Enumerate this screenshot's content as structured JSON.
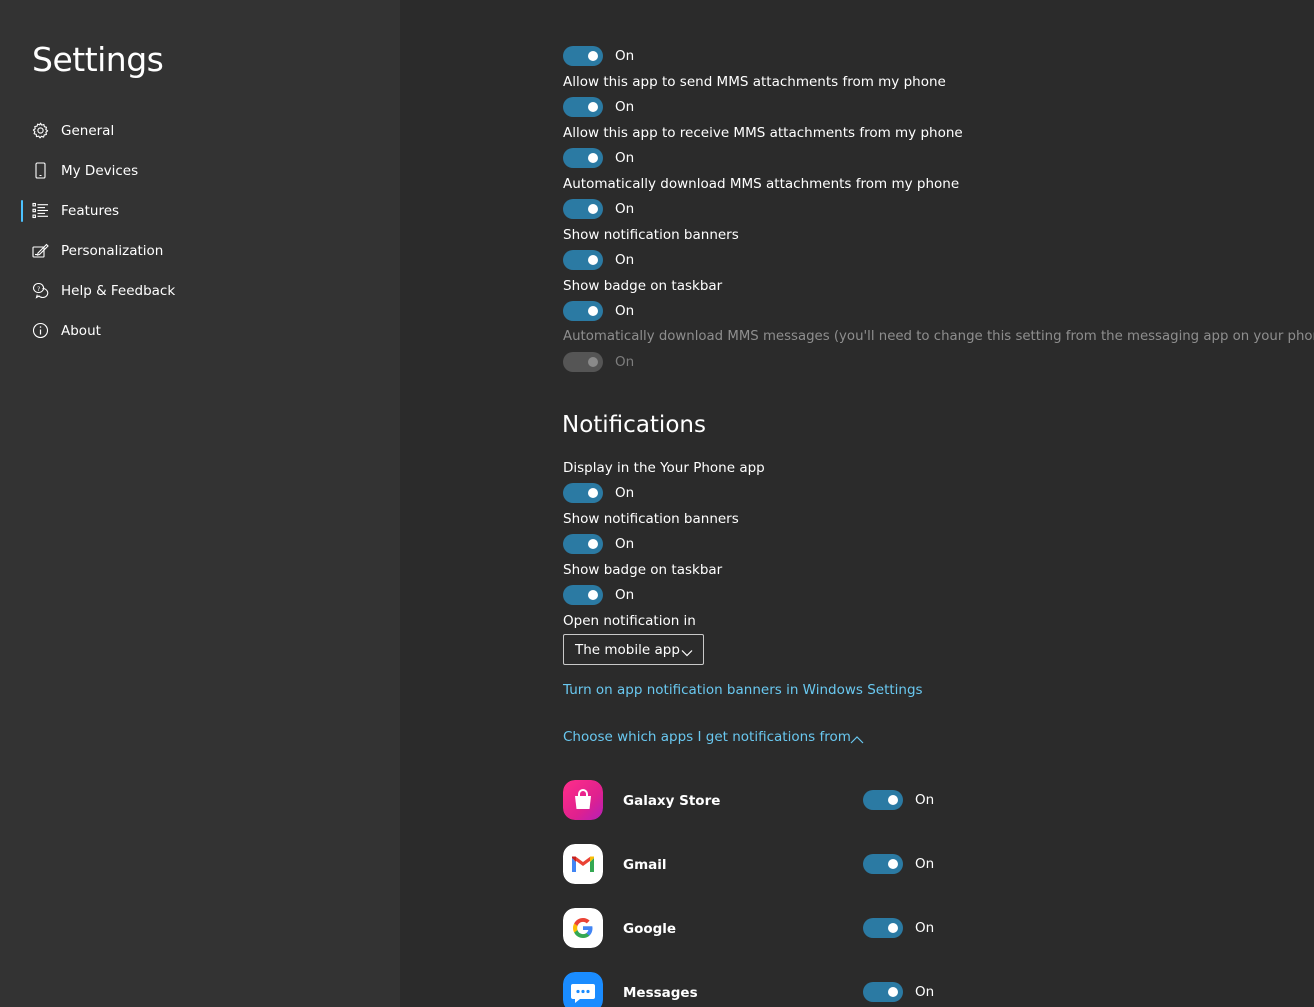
{
  "app": {
    "title": "Settings"
  },
  "nav": {
    "items": [
      {
        "label": "General",
        "icon": "gear-icon"
      },
      {
        "label": "My Devices",
        "icon": "phone-icon"
      },
      {
        "label": "Features",
        "icon": "list-icon",
        "selected": true
      },
      {
        "label": "Personalization",
        "icon": "paint-icon"
      },
      {
        "label": "Help & Feedback",
        "icon": "help-icon"
      },
      {
        "label": "About",
        "icon": "info-icon"
      }
    ]
  },
  "messages_settings": [
    {
      "label": "",
      "state": "On",
      "enabled": true
    },
    {
      "label": "Allow this app to send MMS attachments from my phone",
      "state": "On",
      "enabled": true
    },
    {
      "label": "Allow this app to receive MMS attachments from my phone",
      "state": "On",
      "enabled": true
    },
    {
      "label": "Automatically download MMS attachments from my phone",
      "state": "On",
      "enabled": true
    },
    {
      "label": "Show notification banners",
      "state": "On",
      "enabled": true
    },
    {
      "label": "Show badge on taskbar",
      "state": "On",
      "enabled": true
    },
    {
      "label": "Automatically download MMS messages (you'll need to change this setting from the messaging app on your phone)",
      "state": "On",
      "enabled": false
    }
  ],
  "notifications": {
    "title": "Notifications",
    "settings": [
      {
        "label": "Display in the Your Phone app",
        "state": "On"
      },
      {
        "label": "Show notification banners",
        "state": "On"
      },
      {
        "label": "Show badge on taskbar",
        "state": "On"
      }
    ],
    "open_in": {
      "label": "Open notification in",
      "value": "The mobile app"
    },
    "windows_settings_link": "Turn on app notification banners in Windows Settings",
    "choose_apps_link": "Choose which apps I get notifications from",
    "apps": [
      {
        "name": "Galaxy Store",
        "state": "On",
        "icon": "galaxy-store-icon"
      },
      {
        "name": "Gmail",
        "state": "On",
        "icon": "gmail-icon"
      },
      {
        "name": "Google",
        "state": "On",
        "icon": "google-icon"
      },
      {
        "name": "Messages",
        "state": "On",
        "icon": "messages-icon"
      }
    ]
  },
  "colors": {
    "accent": "#2b7aa3",
    "link": "#69c8f0",
    "sidebar": "#333333",
    "background": "#2b2b2b"
  }
}
